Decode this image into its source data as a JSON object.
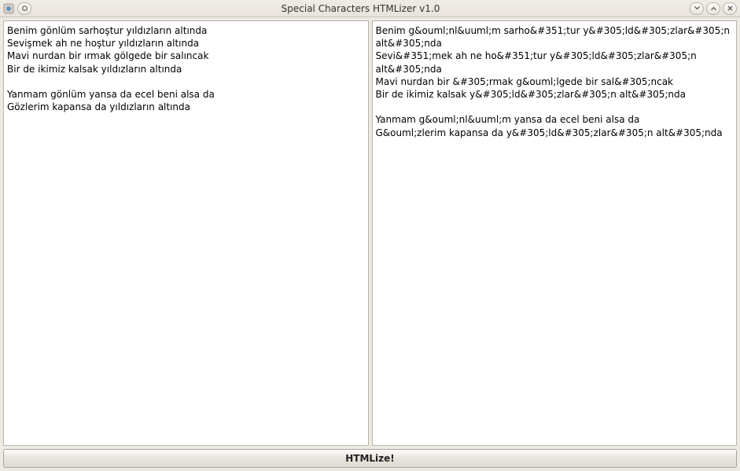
{
  "window": {
    "title": "Special Characters HTMLizer v1.0"
  },
  "input": {
    "text": "Benim gönlüm sarhoştur yıldızların altında\nSevişmek ah ne hoştur yıldızların altında\nMavi nurdan bir ırmak gölgede bir salıncak\nBir de ikimiz kalsak yıldızların altında\n\nYanmam gönlüm yansa da ecel beni alsa da\nGözlerim kapansa da yıldızların altında"
  },
  "output": {
    "text": "Benim g&ouml;nl&uuml;m sarho&#351;tur y&#305;ld&#305;zlar&#305;n alt&#305;nda\nSevi&#351;mek ah ne ho&#351;tur y&#305;ld&#305;zlar&#305;n alt&#305;nda\nMavi nurdan bir &#305;rmak g&ouml;lgede bir sal&#305;ncak\nBir de ikimiz kalsak y&#305;ld&#305;zlar&#305;n alt&#305;nda\n\nYanmam g&ouml;nl&uuml;m yansa da ecel beni alsa da\nG&ouml;zlerim kapansa da y&#305;ld&#305;zlar&#305;n alt&#305;nda"
  },
  "button": {
    "label": "HTMLize!"
  }
}
